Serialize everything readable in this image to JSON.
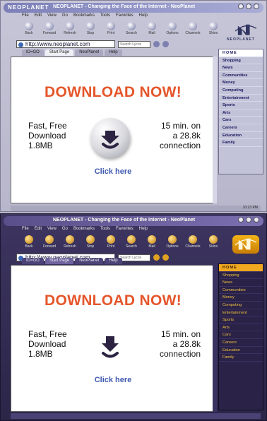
{
  "window1": {
    "brand": "NEOPLANET",
    "title": "NEOPLANET - Changing the Face of the Internet - NeoPlanet",
    "menu": [
      "File",
      "Edit",
      "View",
      "Go",
      "Bookmarks",
      "Tools",
      "Favorites",
      "Help"
    ],
    "toolbar": [
      "Back",
      "Forward",
      "Refresh",
      "Stop",
      "Print",
      "Search",
      "Mail",
      "Options",
      "Channels",
      "Skins"
    ],
    "logo_text": "NEOPLANET",
    "url": "http://www.neoplanet.com",
    "search_placeholder": "Search Lycos",
    "tabs": [
      "ID=GO",
      "Start Page",
      "NeoPlanet",
      "Help"
    ],
    "content": {
      "headline": "DOWNLOAD NOW!",
      "left_line1": "Fast, Free",
      "left_line2": "Download",
      "left_line3": "1.8MB",
      "right_line1": "15 min. on",
      "right_line2": "a 28.8k",
      "right_line3": "connection",
      "click": "Click here"
    },
    "sidebar": [
      "HOME",
      "Shopping",
      "News",
      "Communities",
      "Money",
      "Computing",
      "Entertainment",
      "Sports",
      "Arts",
      "Cars",
      "Careers",
      "Education",
      "Family"
    ],
    "status_clock": "10:23 PM"
  },
  "window2": {
    "title": "NEOPLANET - Changing the Face of the Internet - NeoPlanet",
    "menu": [
      "File",
      "Edit",
      "View",
      "Go",
      "Bookmarks",
      "Tools",
      "Favorites",
      "Help"
    ],
    "toolbar": [
      "Back",
      "Forward",
      "Refresh",
      "Stop",
      "Print",
      "Search",
      "Mail",
      "Options",
      "Channels",
      "Skins"
    ],
    "url": "http://www.neoplanet.com",
    "search_placeholder": "Search Lycos",
    "tabs": [
      "ID=GO",
      "Start Page",
      "NeoPlanet",
      "Help"
    ],
    "content": {
      "headline": "DOWNLOAD NOW!",
      "left_line1": "Fast, Free",
      "left_line2": "Download",
      "left_line3": "1.8MB",
      "right_line1": "15 min. on",
      "right_line2": "a 28.8k",
      "right_line3": "connection",
      "click": "Click here"
    },
    "sidebar": [
      "HOME",
      "Shopping",
      "News",
      "Communities",
      "Money",
      "Computing",
      "Entertainment",
      "Sports",
      "Arts",
      "Cars",
      "Careers",
      "Education",
      "Family"
    ]
  },
  "colors": {
    "headline": "#e5562b",
    "link": "#3f5ab0",
    "skin1_chrome": "#c7c6d8",
    "skin2_chrome": "#2b2548",
    "skin2_accent": "#f0a820"
  }
}
